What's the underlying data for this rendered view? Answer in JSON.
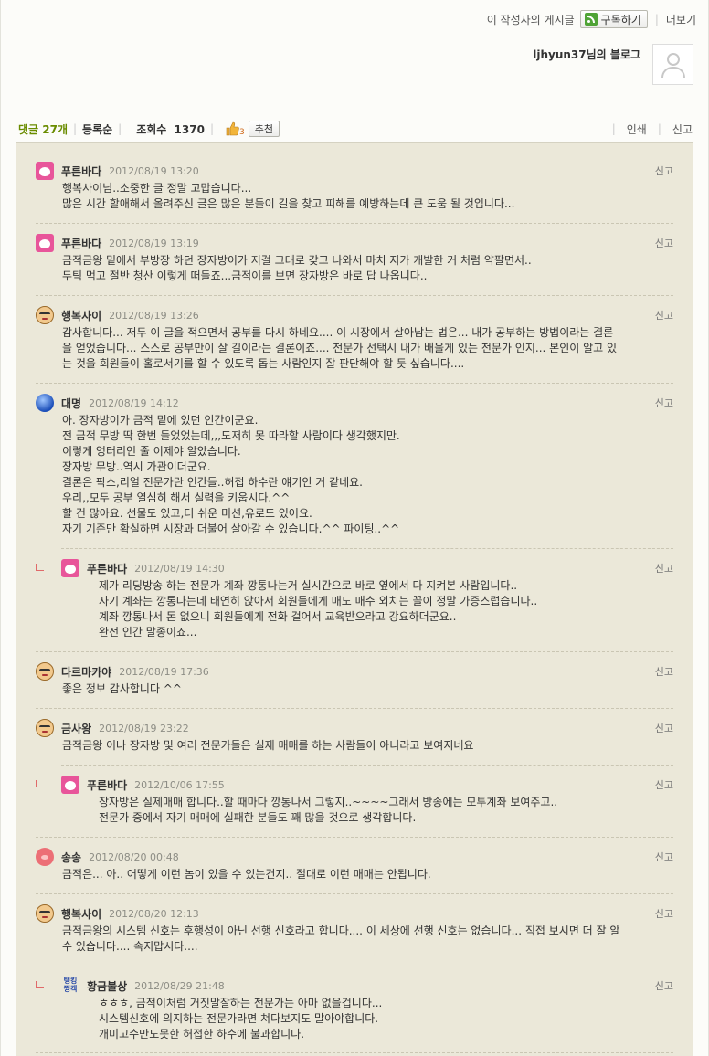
{
  "topbar": {
    "author_posts": "이 작성자의 게시글",
    "subscribe": "구독하기",
    "more": "더보기"
  },
  "blog": {
    "name": "ljhyun37님의 블로그"
  },
  "stats": {
    "comments": "댓글 27개",
    "order": "등록순",
    "views_label": "조회수",
    "views_value": "1370",
    "likes": "3",
    "recommend": "추천",
    "print": "인쇄",
    "report": "신고"
  },
  "comments": [
    {
      "name": "푸른바다",
      "date": "2012/08/19 13:20",
      "report": "신고",
      "icon": "pink-face-icon",
      "text": "행복사이님..소중한 글 정말 고맙습니다...\n많은 시간 할애해서 올려주신 글은 많은 분들이 길을 찾고 피해를 예방하는데 큰 도움 될 것입니다..."
    },
    {
      "name": "푸른바다",
      "date": "2012/08/19 13:19",
      "report": "신고",
      "icon": "pink-face-icon",
      "text": "금적금왕 밑에서 부방장 하던 장자방이가 저걸 그대로 갖고 나와서 마치 지가 개발한 거 처럼 약팔면서..\n두틱 먹고 절반 청산 이렇게 떠들죠...금적이를 보면 장자방은 바로 답 나옵니다.."
    },
    {
      "name": "행복사이",
      "date": "2012/08/19 13:26",
      "report": "신고",
      "icon": "glasses-face-icon",
      "text": "감사합니다... 저두 이 글을 적으면서 공부를 다시 하네요.... 이 시장에서 살아남는 법은... 내가 공부하는 방법이라는 결론\n을 얻었습니다... 스스로 공부만이 살 길이라는 결론이죠.... 전문가 선택시 내가 배울게 있는 전문가 인지... 본인이 알고 있\n는 것을 회원들이 홀로서기를 할 수 있도록 돕는 사람인지 잘 판단해야 할 듯 싶습니다...."
    },
    {
      "name": "대명",
      "date": "2012/08/19 14:12",
      "report": "신고",
      "icon": "blue-orb-icon",
      "text": "아. 장자방이가 금적 밑에 있던 인간이군요.\n전 금적 무방 딱 한번 들었었는데,,,도저히 못 따라할 사람이다 생각했지만.\n이렇게 엉터리인 줄 이제야 알았습니다.\n장자방 무방..역시 가관이더군요.\n결론은 팍스,리얼 전문가란 인간들..허접 하수란 얘기인 거 같네요.\n우리,,모두 공부 열심히 해서 실력을 키웁시다.^^\n할 건 많아요. 선물도 있고,더 쉬운 미션,유로도 있어요.\n자기 기준만 확실하면 시장과 더불어 살아갈 수 있습니다.^^ 파이팅..^^"
    },
    {
      "name": "푸른바다",
      "date": "2012/08/19 14:30",
      "report": "신고",
      "icon": "pink-face-icon",
      "text": "제가 리딩방송 하는 전문가 계좌 깡통나는거 실시간으로 바로 옆에서 다 지켜본 사람입니다..\n자기 계좌는 깡통나는데 태연히 앉아서 회원들에게 매도 매수 외치는 꼴이 정말 가증스럽습니다..\n계좌 깡통나서 돈 없으니 회원들에게 전화 걸어서 교육받으라고 강요하더군요..\n완전 인간 말종이죠..."
    },
    {
      "name": "다르마카야",
      "date": "2012/08/19 17:36",
      "report": "신고",
      "icon": "glasses-face-icon",
      "text": "좋은 정보 감사합니다 ^^"
    },
    {
      "name": "금사왕",
      "date": "2012/08/19 23:22",
      "report": "신고",
      "icon": "glasses-face-icon",
      "text": "금적금왕 이나 장자방 및 여러 전문가들은 실제 매매를 하는 사람들이 아니라고 보여지네요"
    },
    {
      "name": "푸른바다",
      "date": "2012/10/06 17:55",
      "report": "신고",
      "icon": "pink-face-icon",
      "text": "장자방은 실제매매 합니다..할 때마다 깡통나서 그렇지..~~~~그래서 방송에는 모투계좌 보여주고..\n전문가 중에서 자기 매매에 실패한 분들도 꽤 많을 것으로 생각합니다."
    },
    {
      "name": "송송",
      "date": "2012/08/20 00:48",
      "report": "신고",
      "icon": "pig-icon",
      "text": "금적은... 아.. 어떻게 이런 놈이 있을 수 있는건지.. 절대로 이런 매매는 안됩니다."
    },
    {
      "name": "행복사이",
      "date": "2012/08/20 12:13",
      "report": "신고",
      "icon": "glasses-face-icon",
      "text": "금적금왕의 시스템 신호는 후행성이 아닌 선행 신호라고 합니다.... 이 세상에 선행 신호는 없습니다... 직접 보시면 더 잘 알\n수 있습니다.... 속지맙시다...."
    },
    {
      "name": "황금불상",
      "date": "2012/08/29 21:48",
      "report": "신고",
      "icon": "text-badge-icon",
      "badge_top": "탱킹",
      "badge_bottom": "찡켁",
      "text": "ㅎㅎㅎ, 금적이처럼 거짓말잘하는 전문가는 아마 없을겁니다...\n시스템신호에 의지하는 전문가라면 쳐다보지도 말아야합니다.\n개미고수만도못한 허접한 하수에 불과합니다."
    }
  ]
}
